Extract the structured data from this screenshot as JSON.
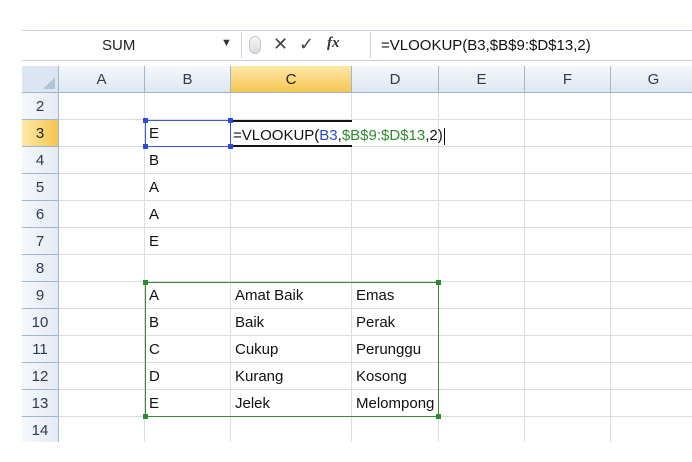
{
  "name_box": {
    "value": "SUM"
  },
  "formula_bar": {
    "text": "=VLOOKUP(B3,$B$9:$D$13,2)",
    "fx_label": "fx",
    "cancel_glyph": "✕",
    "enter_glyph": "✓"
  },
  "icons": {
    "cancel": "cancel-icon",
    "enter": "checkmark-icon",
    "function": "insert-function-icon",
    "dropdown": "chevron-down-icon"
  },
  "columns": [
    "A",
    "B",
    "C",
    "D",
    "E",
    "F",
    "G"
  ],
  "rows": [
    "2",
    "3",
    "4",
    "5",
    "6",
    "7",
    "8",
    "9",
    "10",
    "11",
    "12",
    "13",
    "14"
  ],
  "active_cell": {
    "column": "C",
    "row": "3"
  },
  "editing": {
    "prefix": "=VLOOKUP(",
    "ref1": "B3",
    "sep1": ",",
    "ref2": "$B$9:$D$13",
    "suffix": ",2)"
  },
  "cells": {
    "B3": "E",
    "B4": "B",
    "B5": "A",
    "B6": "A",
    "B7": "E",
    "B9": "A",
    "C9": "Amat Baik",
    "D9": "Emas",
    "B10": "B",
    "C10": "Baik",
    "D10": "Perak",
    "B11": "C",
    "C11": "Cukup",
    "D11": "Perunggu",
    "B12": "D",
    "C12": "Kurang",
    "D12": "Kosong",
    "B13": "E",
    "C13": "Jelek",
    "D13": "Melompong"
  },
  "colors": {
    "ref_b3": "#2b4bd6",
    "ref_range": "#2e8a2e",
    "header_active": "#f6c552",
    "header_bg": "#dfe7f1",
    "gridline": "#dadcdd"
  }
}
